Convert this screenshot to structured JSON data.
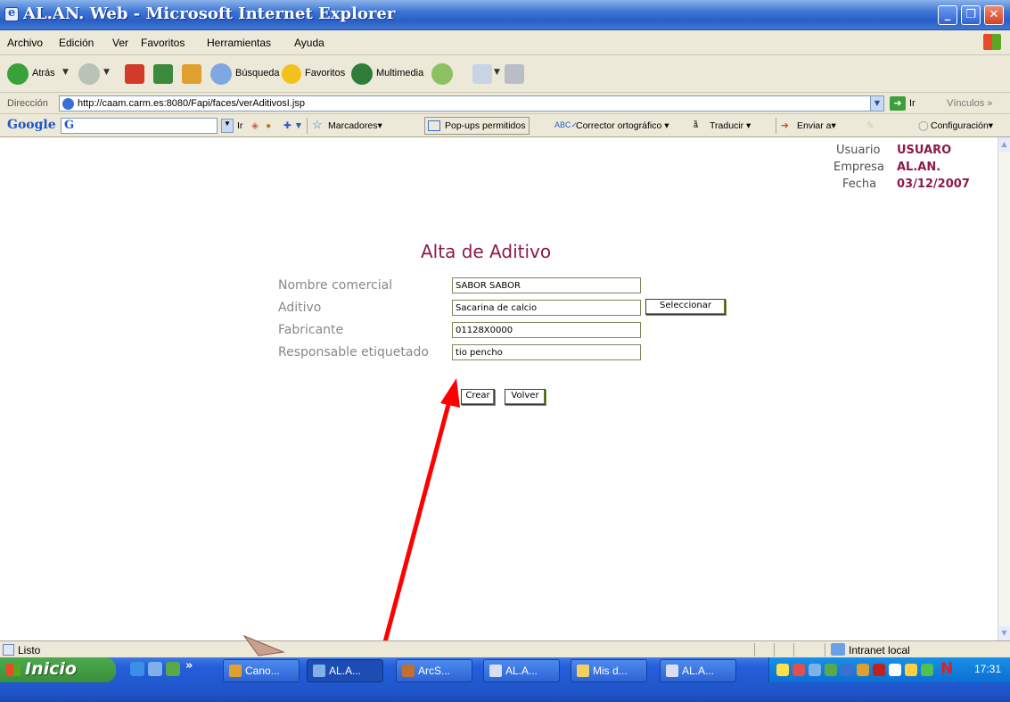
{
  "window": {
    "title": "AL.AN. Web - Microsoft Internet Explorer"
  },
  "menu": {
    "items": [
      "Archivo",
      "Edición",
      "Ver",
      "Favoritos",
      "Herramientas",
      "Ayuda"
    ]
  },
  "toolbar": {
    "back": "Atrás",
    "search": "Búsqueda",
    "favorites": "Favoritos",
    "multimedia": "Multimedia"
  },
  "address": {
    "label": "Dirección",
    "url": "http://caam.carm.es:8080/Fapi/faces/verAditivosI.jsp",
    "go": "Ir",
    "links": "Vínculos",
    "links_more": "»"
  },
  "google": {
    "logo": "Google",
    "logo_g": "G",
    "go": "Ir",
    "bookmarks": "Marcadores",
    "popups": "Pop-ups permitidos",
    "spellcheck": "Corrector ortográfico",
    "translate": "Traducir",
    "send": "Enviar a",
    "settings": "Configuración"
  },
  "user_info": {
    "usuario_label": "Usuario",
    "usuario_value": "USUARO",
    "empresa_label": "Empresa",
    "empresa_value": "AL.AN.",
    "fecha_label": "Fecha",
    "fecha_value": "03/12/2007"
  },
  "form": {
    "title": "Alta de Aditivo",
    "fields": [
      {
        "label": "Nombre comercial",
        "value": "SABOR SABOR"
      },
      {
        "label": "Aditivo",
        "value": "Sacarina de calcio"
      },
      {
        "label": "Fabricante",
        "value": "01128X0000"
      },
      {
        "label": "Responsable etiquetado",
        "value": "tio pencho"
      }
    ],
    "select_button": "Seleccionar",
    "create_button": "Crear",
    "back_button": "Volver"
  },
  "status": {
    "text": "Listo",
    "zone": "Intranet local"
  },
  "taskbar": {
    "start": "Inicio",
    "quicklaunch_more": "»",
    "tasks": [
      "Cano...",
      "AL.A...",
      "ArcS...",
      "AL.A...",
      "Mis d...",
      "AL.A..."
    ],
    "clock": "17:31"
  },
  "colors": {
    "accent": "#8b1a4a",
    "label_gray": "#888888",
    "annotation": "#ff0000"
  }
}
